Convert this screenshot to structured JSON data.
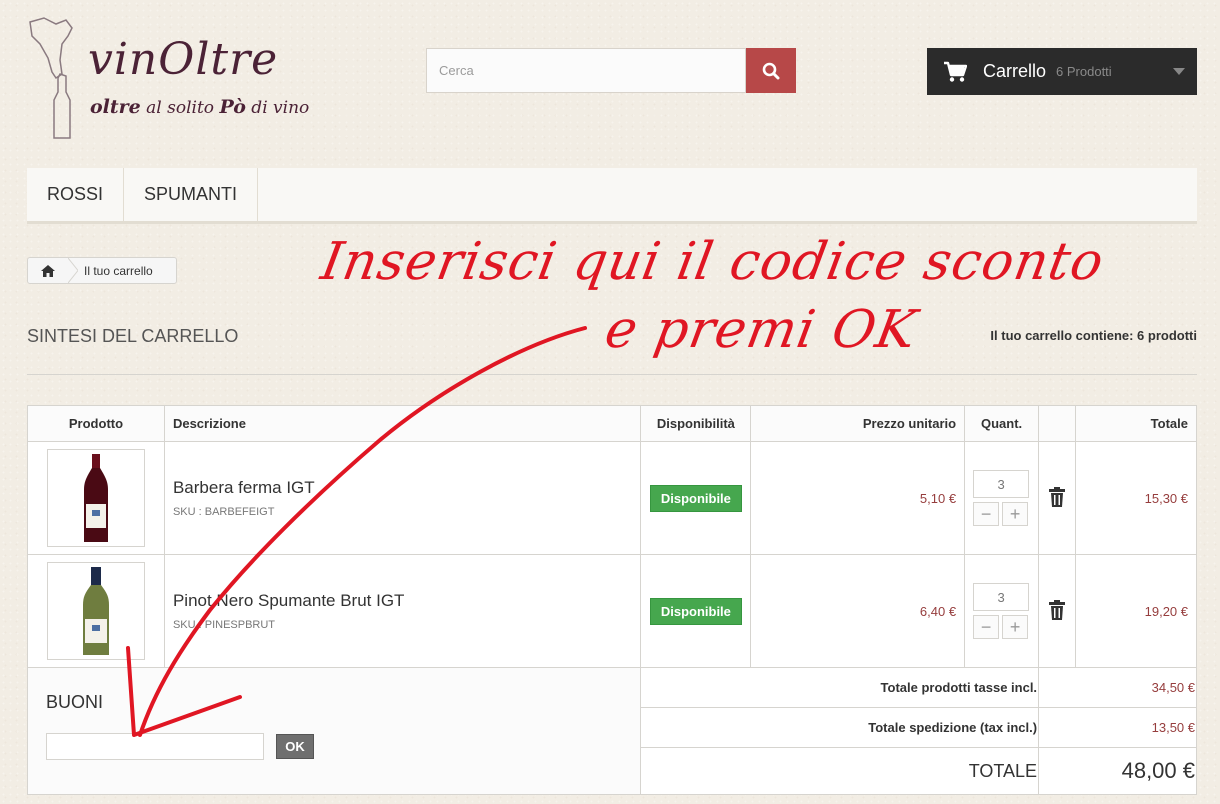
{
  "logo": {
    "title": "vinOltre",
    "tagline_1": "oltre",
    "tagline_2": " al solito ",
    "tagline_3": "Pò",
    "tagline_4": " di vino"
  },
  "search": {
    "placeholder": "Cerca"
  },
  "cart": {
    "label": "Carrello",
    "count": "6 Prodotti"
  },
  "menu": {
    "items": [
      {
        "label": "Rossi"
      },
      {
        "label": "Spumanti"
      }
    ]
  },
  "breadcrumb": {
    "current": "Il tuo carrello"
  },
  "page": {
    "heading": "Sintesi del carrello",
    "summary": "Il tuo carrello contiene: 6 prodotti"
  },
  "table": {
    "headers": {
      "product": "Prodotto",
      "description": "Descrizione",
      "availability": "Disponibilità",
      "unit_price": "Prezzo unitario",
      "qty": "Quant.",
      "total": "Totale"
    },
    "rows": [
      {
        "name": "Barbera ferma IGT",
        "sku": "SKU : BARBEFEIGT",
        "availability": "Disponibile",
        "unit_price": "5,10 €",
        "qty": "3",
        "total": "15,30 €"
      },
      {
        "name": "Pinot Nero Spumante Brut IGT",
        "sku": "SKU : PINESPBRUT",
        "availability": "Disponibile",
        "unit_price": "6,40 €",
        "qty": "3",
        "total": "19,20 €"
      }
    ]
  },
  "vouchers": {
    "title": "Buoni",
    "ok_label": "OK"
  },
  "totals": {
    "products_label": "Totale prodotti tasse incl.",
    "products_value": "34,50 €",
    "shipping_label": "Totale spedizione (tax incl.)",
    "shipping_value": "13,50 €",
    "grand_label": "Totale",
    "grand_value": "48,00 €"
  },
  "annotation": {
    "line1": "Inserisci qui il codice sconto",
    "line2": "e premi OK",
    "color": "#e01623"
  },
  "colors": {
    "accent_red": "#b74848",
    "available_green": "#46a74e",
    "price_red": "#963d3d",
    "cart_bg": "#2b2b2b"
  }
}
